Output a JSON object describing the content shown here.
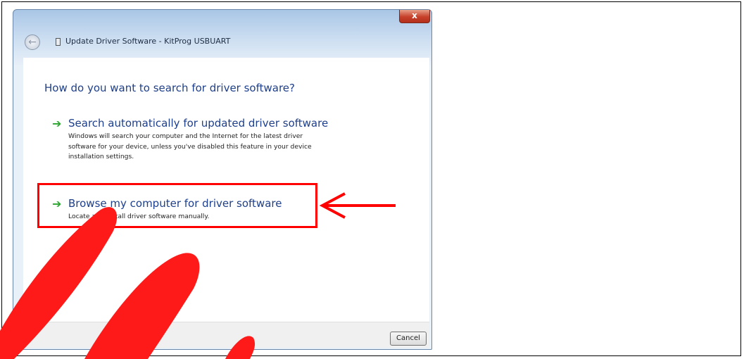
{
  "window": {
    "title": "Update Driver Software - KitProg USBUART",
    "close_label": "x",
    "back_label": "←"
  },
  "main": {
    "heading": "How do you want to search for driver software?",
    "options": [
      {
        "title": "Search automatically for updated driver software",
        "desc_lines": [
          "Windows will search your computer and the Internet for the latest driver",
          "software for your device, unless you've disabled this feature in your device",
          "installation settings."
        ]
      },
      {
        "title": "Browse my computer for driver software",
        "desc_lines": [
          "Locate and install driver software manually."
        ]
      }
    ],
    "option_arrow": "➔"
  },
  "footer": {
    "cancel_label": "Cancel"
  },
  "annotations": {
    "highlight_color": "#ff0000",
    "watermark_color": "#ff1a1a"
  }
}
